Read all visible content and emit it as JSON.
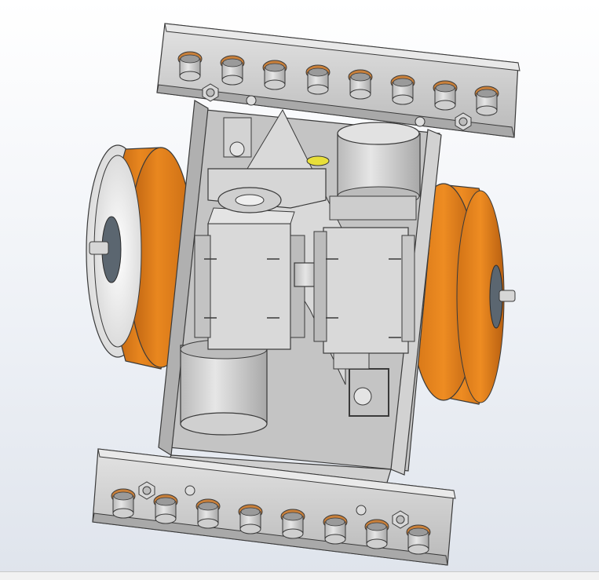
{
  "window": {
    "content": "cad-3d-model-viewport",
    "model": "dual-wheel-drive-module-assembly"
  },
  "colors": {
    "background_top": "#ffffff",
    "background_bottom": "#dfe4ec",
    "steel": "#c8c8c8",
    "steel_dark": "#9a9a9a",
    "edge": "#3a3a3a",
    "wheel_tread": "#e07e1e",
    "wheel_tread_dark": "#b85f10",
    "wheel_hub": "#f4f4f4",
    "bearing_brown": "#c9803a",
    "motor": "#d4d4d4"
  }
}
